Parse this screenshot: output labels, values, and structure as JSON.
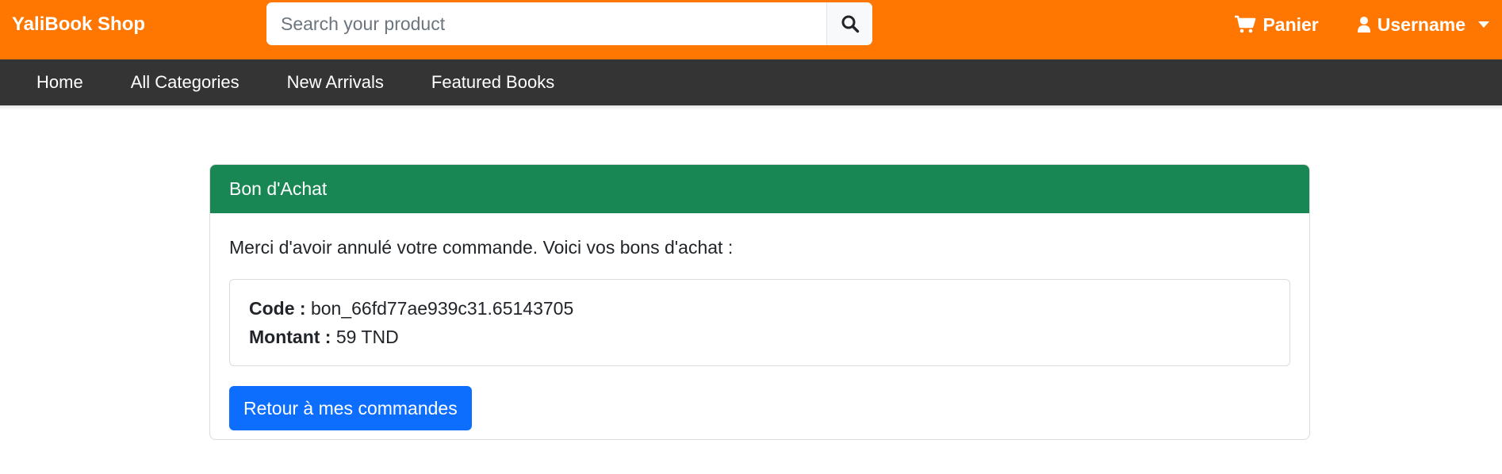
{
  "brand": "YaliBook Shop",
  "search": {
    "placeholder": "Search your product",
    "value": ""
  },
  "header_nav": {
    "cart_label": "Panier",
    "user_label": "Username"
  },
  "subnav": [
    {
      "label": "Home"
    },
    {
      "label": "All Categories"
    },
    {
      "label": "New Arrivals"
    },
    {
      "label": "Featured Books"
    }
  ],
  "card": {
    "title": "Bon d'Achat",
    "intro": "Merci d'avoir annulé votre commande. Voici vos bons d'achat :",
    "voucher": {
      "code_label": "Code :",
      "code_value": "bon_66fd77ae939c31.65143705",
      "amount_label": "Montant :",
      "amount_value": "59 TND"
    },
    "back_button": "Retour à mes commandes"
  },
  "colors": {
    "topbar": "#ff7700",
    "subnav": "#343434",
    "card_header": "#198754",
    "primary_button": "#0d6efd"
  },
  "icons": [
    "search-icon",
    "cart-icon",
    "user-icon",
    "caret-down-icon"
  ]
}
